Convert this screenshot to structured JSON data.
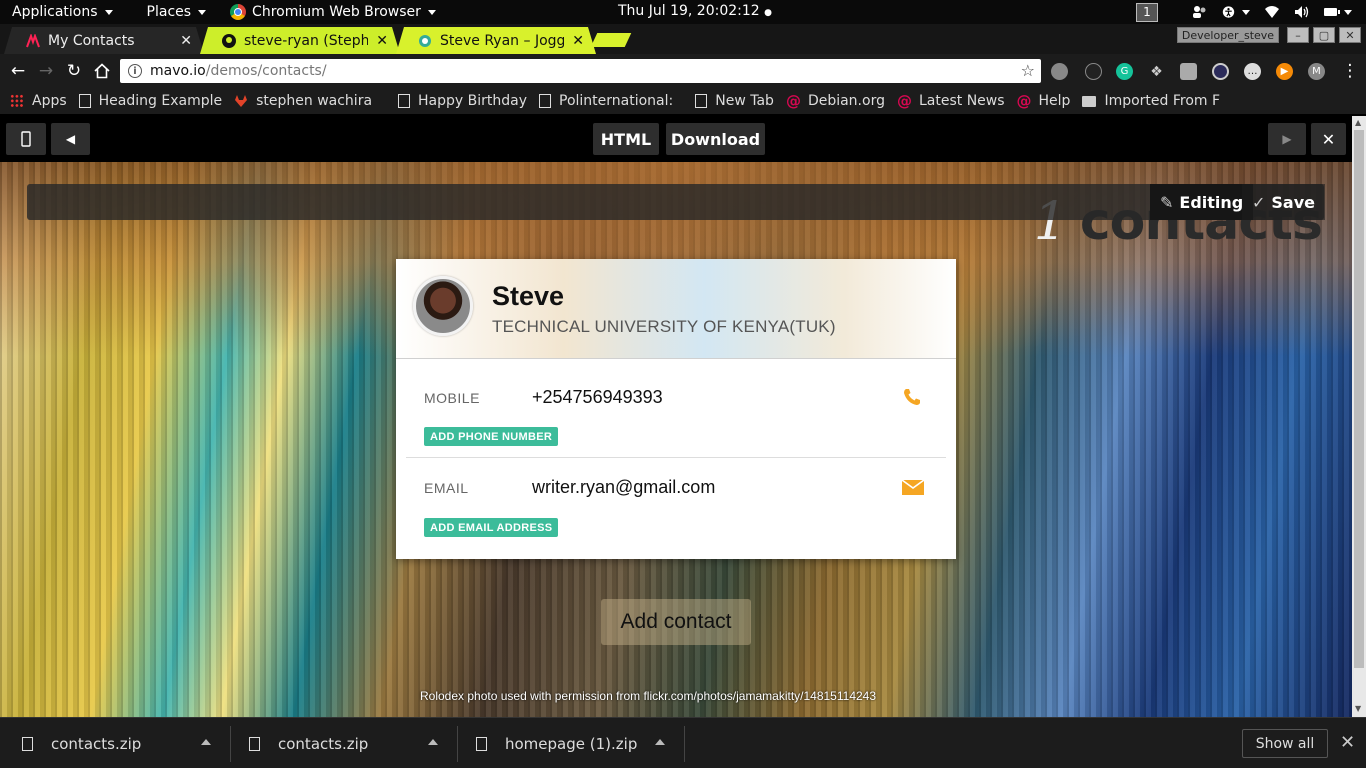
{
  "system_bar": {
    "applications": "Applications",
    "places": "Places",
    "browser": "Chromium Web Browser",
    "clock": "Thu Jul 19, 20:02:12",
    "workspace": "1"
  },
  "tabs": [
    {
      "title": "My Contacts"
    },
    {
      "title": "steve-ryan (Stephen"
    },
    {
      "title": "Steve Ryan – Joggin"
    }
  ],
  "window": {
    "profile": "Developer_steve"
  },
  "omnibox": {
    "host": "mavo.io",
    "path": "/demos/contacts/"
  },
  "bookmarks": [
    {
      "label": "Apps"
    },
    {
      "label": "Heading Example"
    },
    {
      "label": "stephen wachira"
    },
    {
      "label": "Happy Birthday"
    },
    {
      "label": "Polinternational:"
    },
    {
      "label": "New Tab"
    },
    {
      "label": "Debian.org"
    },
    {
      "label": "Latest News"
    },
    {
      "label": "Help"
    },
    {
      "label": "Imported From F"
    }
  ],
  "mavo_bar": {
    "html": "HTML",
    "download": "Download"
  },
  "app": {
    "count": "1",
    "count_label": "contacts",
    "editing": "Editing",
    "save": "Save",
    "contact": {
      "name": "Steve",
      "org": "TECHNICAL UNIVERSITY OF KENYA(TUK)",
      "mobile_label": "MOBILE",
      "mobile": "+254756949393",
      "add_phone": "ADD PHONE NUMBER",
      "email_label": "EMAIL",
      "email": "writer.ryan@gmail.com",
      "add_email": "ADD EMAIL ADDRESS"
    },
    "add_contact": "Add contact",
    "credit": "Rolodex photo used with permission from flickr.com/photos/jamamakitty/14815114243"
  },
  "downloads": [
    {
      "name": "contacts.zip"
    },
    {
      "name": "contacts.zip"
    },
    {
      "name": "homepage (1).zip"
    }
  ],
  "shelf": {
    "show_all": "Show all"
  },
  "colors": {
    "accent": "#f5a623",
    "pill": "#3cbc9a",
    "active_tab": "#d8f12c"
  }
}
